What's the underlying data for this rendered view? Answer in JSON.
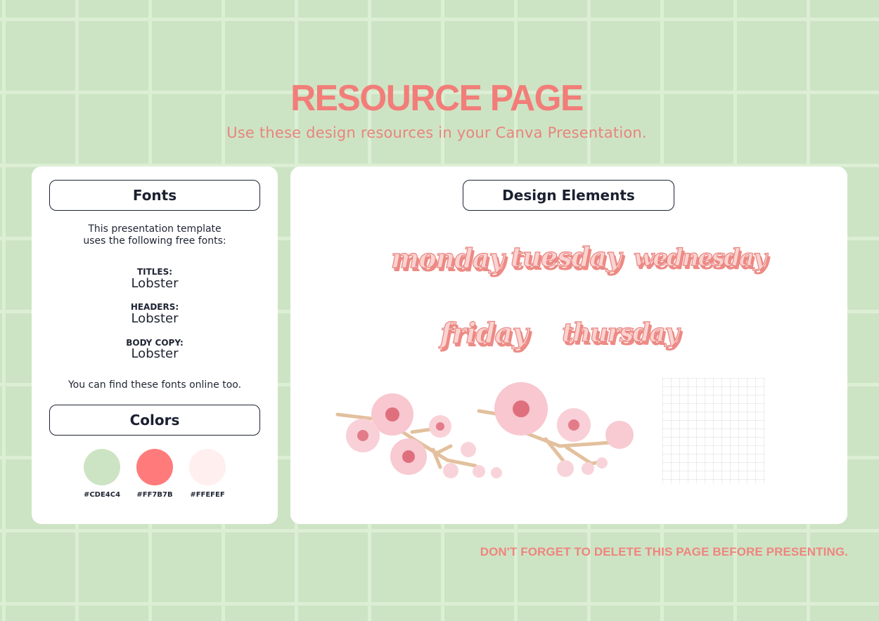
{
  "header": {
    "title": "RESOURCE PAGE",
    "subtitle": "Use these design resources in your Canva Presentation."
  },
  "fonts_card": {
    "heading": "Fonts",
    "intro_line1": "This presentation template",
    "intro_line2": "uses the following free fonts:",
    "entries": [
      {
        "label": "TITLES:",
        "font": "Lobster"
      },
      {
        "label": "HEADERS:",
        "font": "Lobster"
      },
      {
        "label": "BODY COPY:",
        "font": "Lobster"
      }
    ],
    "outro": "You can find these fonts online too.",
    "colors_heading": "Colors",
    "colors": [
      {
        "hex": "#CDE4C4",
        "label": "#CDE4C4"
      },
      {
        "hex": "#FF7B7B",
        "label": "#FF7B7B"
      },
      {
        "hex": "#FFEFEF",
        "label": "#FFEFEF"
      }
    ]
  },
  "design_card": {
    "heading": "Design Elements",
    "stickers": [
      "monday",
      "tuesday",
      "wednesday",
      "friday",
      "thursday"
    ],
    "images": [
      "cherry-blossom-branch",
      "cherry-blossom-branch",
      "grid-paper"
    ]
  },
  "footer": {
    "note": "DON'T FORGET TO DELETE THIS PAGE BEFORE PRESENTING."
  }
}
